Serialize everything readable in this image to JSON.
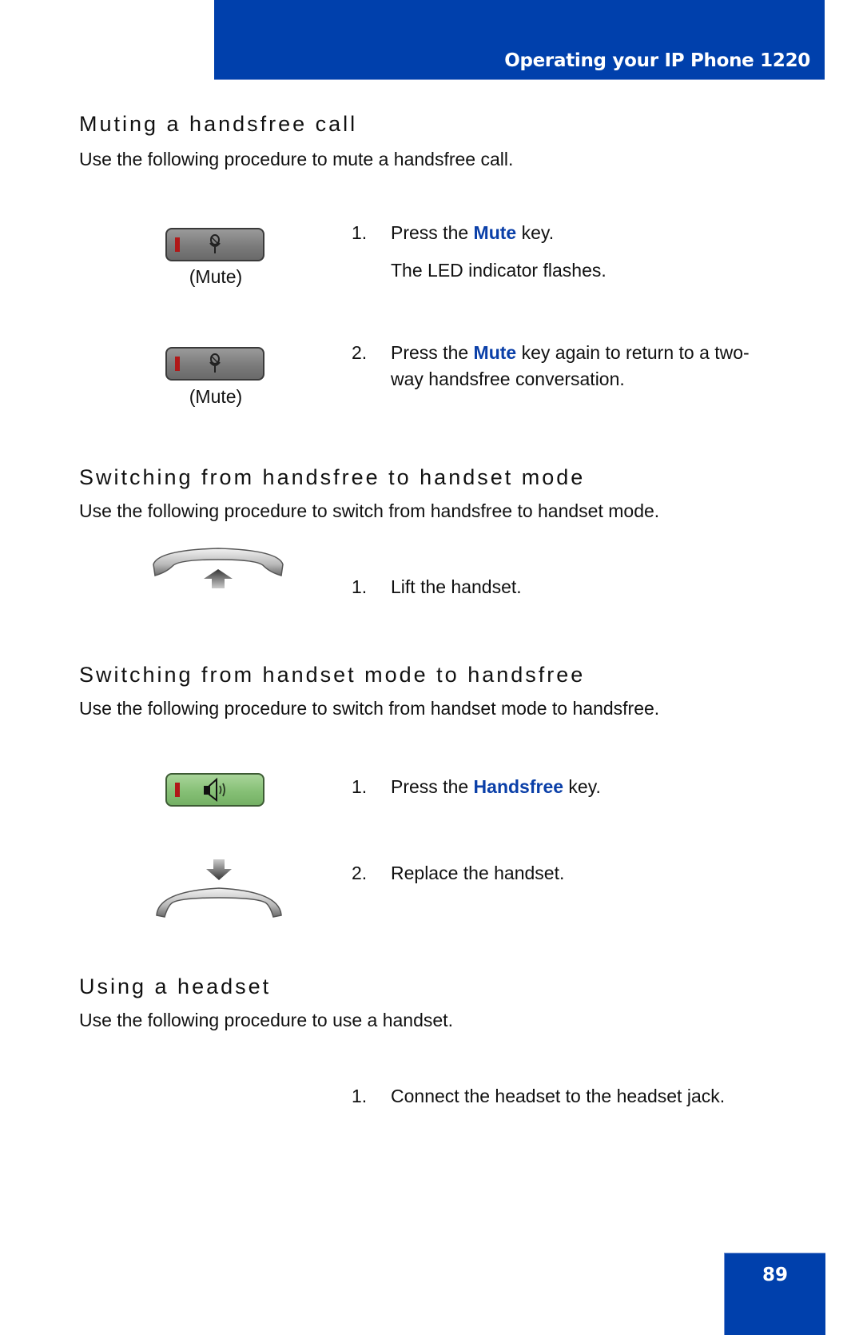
{
  "header": {
    "title": "Operating your IP Phone 1220"
  },
  "sections": [
    {
      "heading": "Muting a handsfree call",
      "description": "Use the following procedure to mute a handsfree call.",
      "steps": [
        {
          "number": "1.",
          "pre": "Press the ",
          "key": "Mute",
          "post": " key.",
          "note": "The LED indicator flashes.",
          "icon": "mute-key-icon",
          "caption": "(Mute)"
        },
        {
          "number": "2.",
          "pre": "Press the ",
          "key": "Mute",
          "post": " key again to return to a two-way handsfree conversation.",
          "icon": "mute-key-icon",
          "caption": "(Mute)"
        }
      ]
    },
    {
      "heading": "Switching from handsfree to handset mode",
      "description": "Use the following procedure to switch from handsfree to handset mode.",
      "steps": [
        {
          "number": "1.",
          "text": "Lift the handset.",
          "icon": "lift-handset-icon"
        }
      ]
    },
    {
      "heading": "Switching from handset mode to handsfree",
      "description": "Use the following procedure to switch from handset mode to handsfree.",
      "steps": [
        {
          "number": "1.",
          "pre": "Press the ",
          "key": "Handsfree",
          "post": " key.",
          "icon": "handsfree-key-icon"
        },
        {
          "number": "2.",
          "text": "Replace the handset.",
          "icon": "replace-handset-icon"
        }
      ]
    },
    {
      "heading": "Using a headset",
      "description": "Use the following procedure to use a handset.",
      "steps": [
        {
          "number": "1.",
          "text": "Connect the headset to the headset jack."
        }
      ]
    }
  ],
  "footer": {
    "page_number": "89"
  },
  "colors": {
    "brand_blue": "#0040ac",
    "key_highlight": "#0a3fa8",
    "led_red": "#b01818",
    "handsfree_green": "#86c076"
  }
}
